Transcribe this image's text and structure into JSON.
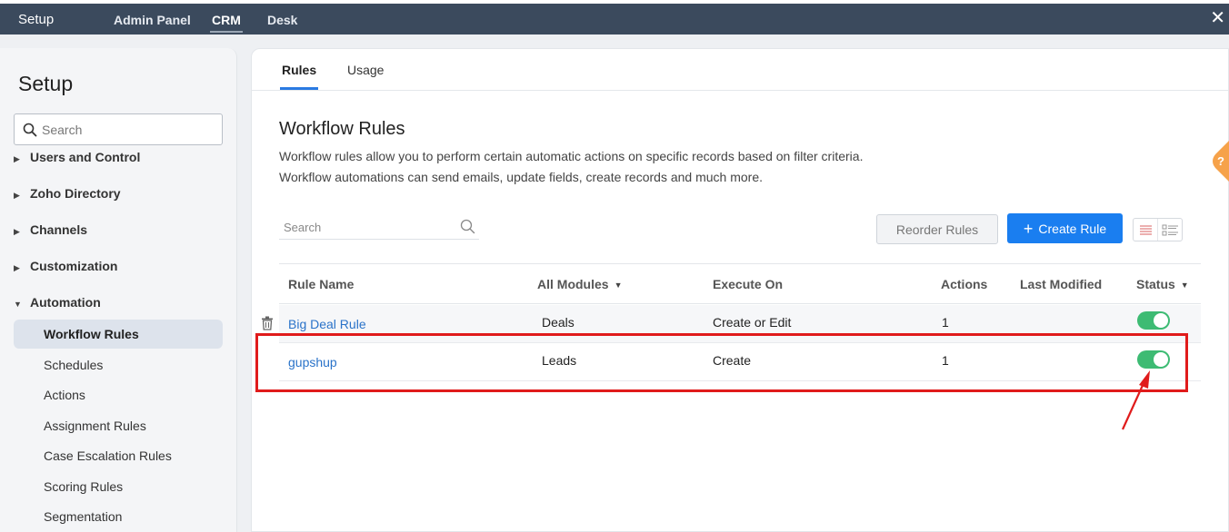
{
  "topbar": {
    "brand": "Setup",
    "nav": [
      {
        "label": "Admin Panel",
        "active": false
      },
      {
        "label": "CRM",
        "active": true
      },
      {
        "label": "Desk",
        "active": false
      }
    ],
    "close": "✕"
  },
  "sidebar": {
    "title": "Setup",
    "search_placeholder": "Search",
    "categories": [
      {
        "label": "Users and Control",
        "expanded": false
      },
      {
        "label": "Zoho Directory",
        "expanded": false
      },
      {
        "label": "Channels",
        "expanded": false
      },
      {
        "label": "Customization",
        "expanded": false
      },
      {
        "label": "Automation",
        "expanded": true
      }
    ],
    "arrows": {
      "collapsed": "▶",
      "expanded": "▼"
    },
    "automation_items": [
      {
        "label": "Workflow Rules",
        "selected": true
      },
      {
        "label": "Schedules",
        "selected": false
      },
      {
        "label": "Actions",
        "selected": false
      },
      {
        "label": "Assignment Rules",
        "selected": false
      },
      {
        "label": "Case Escalation Rules",
        "selected": false
      },
      {
        "label": "Scoring Rules",
        "selected": false
      },
      {
        "label": "Segmentation",
        "selected": false
      }
    ]
  },
  "main": {
    "tabs": [
      {
        "label": "Rules",
        "active": true
      },
      {
        "label": "Usage",
        "active": false
      }
    ],
    "heading": "Workflow Rules",
    "description": "Workflow rules allow you to perform certain automatic actions on specific records based on filter criteria. Workflow automations can send emails, update fields, create records and much more.",
    "search_placeholder": "Search",
    "reorder_label": "Reorder Rules",
    "create_plus": "+",
    "create_label": "Create Rule",
    "columns": {
      "rule_name": "Rule Name",
      "modules": "All Modules",
      "execute_on": "Execute On",
      "actions": "Actions",
      "last_modified": "Last Modified",
      "status": "Status"
    },
    "caret": "▼",
    "rows": [
      {
        "name": "Big Deal Rule",
        "module": "Deals",
        "execute_on": "Create or Edit",
        "actions": "1",
        "last_modified": "",
        "status_on": true
      },
      {
        "name": "gupshup",
        "module": "Leads",
        "execute_on": "Create",
        "actions": "1",
        "last_modified": "",
        "status_on": true
      }
    ]
  },
  "help": "?",
  "colors": {
    "topbar": "#3b4a5d",
    "accent": "#1a7ef0",
    "toggle_on": "#3dbb73",
    "annotation": "#e01b1b",
    "help": "#f6a24a"
  }
}
